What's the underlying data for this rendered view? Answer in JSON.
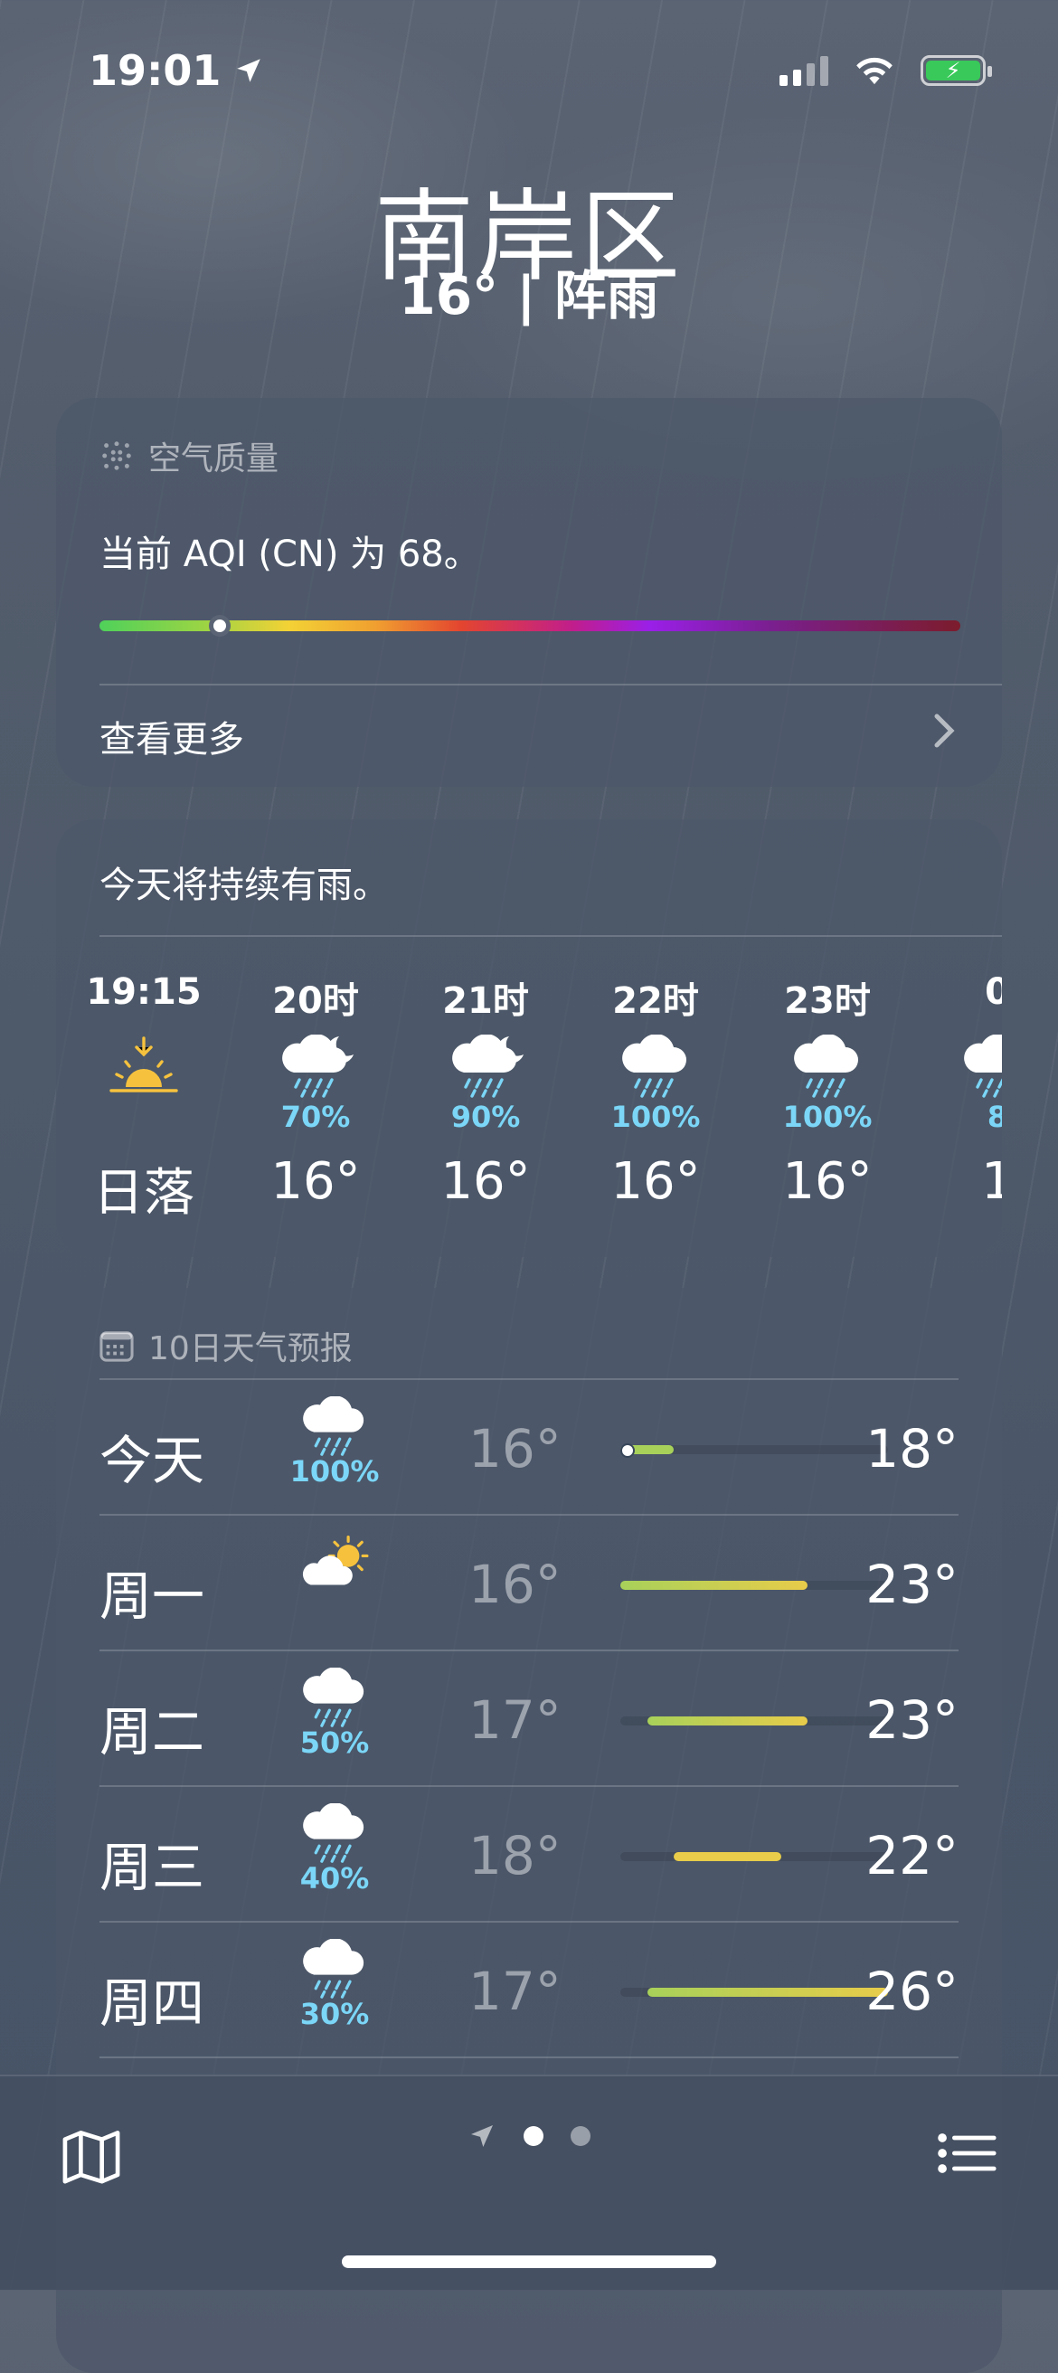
{
  "status_bar": {
    "time": "19:01"
  },
  "header": {
    "city": "南岸区",
    "current": "16° | 阵雨"
  },
  "aqi": {
    "title": "空气质量",
    "text": "当前 AQI (CN) 为 68。",
    "level": 0.14,
    "see_more": "查看更多"
  },
  "hourly": {
    "summary": "今天将持续有雨。",
    "items": [
      {
        "label": "19:15",
        "icon": "sunset-icon",
        "pct": "",
        "temp": "日落"
      },
      {
        "label": "20时",
        "icon": "cloud-moon-rain-icon",
        "pct": "70%",
        "temp": "16°"
      },
      {
        "label": "21时",
        "icon": "cloud-moon-rain-icon",
        "pct": "90%",
        "temp": "16°"
      },
      {
        "label": "22时",
        "icon": "cloud-rain-icon",
        "pct": "100%",
        "temp": "16°"
      },
      {
        "label": "23时",
        "icon": "cloud-rain-icon",
        "pct": "100%",
        "temp": "16°"
      },
      {
        "label": "0",
        "icon": "cloud-rain-icon",
        "pct": "8",
        "temp": "1"
      }
    ]
  },
  "daily": {
    "title": "10日天气预报",
    "range": [
      16,
      26
    ],
    "days": [
      {
        "name": "今天",
        "icon": "cloud-rain-icon",
        "pct": "100%",
        "low": "16°",
        "high": "18°",
        "low_v": 16,
        "high_v": 18,
        "current_v": 16
      },
      {
        "name": "周一",
        "icon": "cloud-sun-icon",
        "pct": "",
        "low": "16°",
        "high": "23°",
        "low_v": 16,
        "high_v": 23
      },
      {
        "name": "周二",
        "icon": "cloud-rain-icon",
        "pct": "50%",
        "low": "17°",
        "high": "23°",
        "low_v": 17,
        "high_v": 23
      },
      {
        "name": "周三",
        "icon": "cloud-rain-icon",
        "pct": "40%",
        "low": "18°",
        "high": "22°",
        "low_v": 18,
        "high_v": 22
      },
      {
        "name": "周四",
        "icon": "cloud-rain-icon",
        "pct": "30%",
        "low": "17°",
        "high": "26°",
        "low_v": 17,
        "high_v": 26
      }
    ]
  },
  "colors": {
    "precip": "#7bd6f7",
    "range_green": "#a8d15a",
    "range_yellow": "#e8cc4a"
  },
  "toolbar": {
    "icons": [
      "map-icon",
      "location-arrow-icon",
      "page-dot-icon",
      "list-icon"
    ]
  }
}
